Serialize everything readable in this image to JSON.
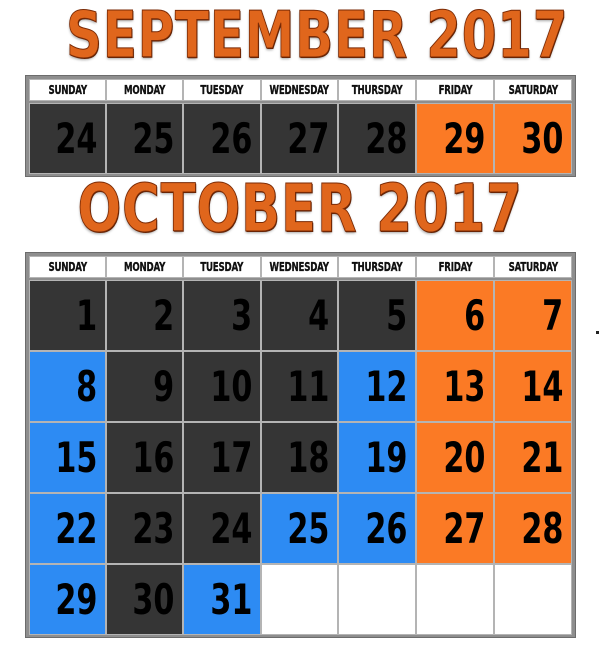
{
  "months": [
    {
      "key": "sep",
      "title": "SEPTEMBER 2017",
      "weekdays": [
        "SUNDAY",
        "MONDAY",
        "TUESDAY",
        "WEDNESDAY",
        "THURSDAY",
        "FRIDAY",
        "SATURDAY"
      ],
      "weeks": [
        [
          {
            "day": "24",
            "color": "dark"
          },
          {
            "day": "25",
            "color": "dark"
          },
          {
            "day": "26",
            "color": "dark"
          },
          {
            "day": "27",
            "color": "dark"
          },
          {
            "day": "28",
            "color": "dark"
          },
          {
            "day": "29",
            "color": "orange"
          },
          {
            "day": "30",
            "color": "orange"
          }
        ]
      ]
    },
    {
      "key": "oct",
      "title": "OCTOBER 2017",
      "weekdays": [
        "SUNDAY",
        "MONDAY",
        "TUESDAY",
        "WEDNESDAY",
        "THURSDAY",
        "FRIDAY",
        "SATURDAY"
      ],
      "weeks": [
        [
          {
            "day": "1",
            "color": "dark"
          },
          {
            "day": "2",
            "color": "dark"
          },
          {
            "day": "3",
            "color": "dark"
          },
          {
            "day": "4",
            "color": "dark"
          },
          {
            "day": "5",
            "color": "dark"
          },
          {
            "day": "6",
            "color": "orange"
          },
          {
            "day": "7",
            "color": "orange"
          }
        ],
        [
          {
            "day": "8",
            "color": "blue"
          },
          {
            "day": "9",
            "color": "dark"
          },
          {
            "day": "10",
            "color": "dark"
          },
          {
            "day": "11",
            "color": "dark"
          },
          {
            "day": "12",
            "color": "blue"
          },
          {
            "day": "13",
            "color": "orange"
          },
          {
            "day": "14",
            "color": "orange"
          }
        ],
        [
          {
            "day": "15",
            "color": "blue"
          },
          {
            "day": "16",
            "color": "dark"
          },
          {
            "day": "17",
            "color": "dark"
          },
          {
            "day": "18",
            "color": "dark"
          },
          {
            "day": "19",
            "color": "blue"
          },
          {
            "day": "20",
            "color": "orange"
          },
          {
            "day": "21",
            "color": "orange"
          }
        ],
        [
          {
            "day": "22",
            "color": "blue"
          },
          {
            "day": "23",
            "color": "dark"
          },
          {
            "day": "24",
            "color": "dark"
          },
          {
            "day": "25",
            "color": "blue"
          },
          {
            "day": "26",
            "color": "blue"
          },
          {
            "day": "27",
            "color": "orange"
          },
          {
            "day": "28",
            "color": "orange"
          }
        ],
        [
          {
            "day": "29",
            "color": "blue"
          },
          {
            "day": "30",
            "color": "dark"
          },
          {
            "day": "31",
            "color": "blue"
          },
          {
            "day": "",
            "color": "white"
          },
          {
            "day": "",
            "color": "white"
          },
          {
            "day": "",
            "color": "white"
          },
          {
            "day": "",
            "color": "white"
          }
        ]
      ]
    }
  ],
  "palette": {
    "dark": "#353535",
    "orange": "#fb7a25",
    "blue": "#2d8bf3",
    "white": "#ffffff",
    "title": "#e0661c"
  }
}
